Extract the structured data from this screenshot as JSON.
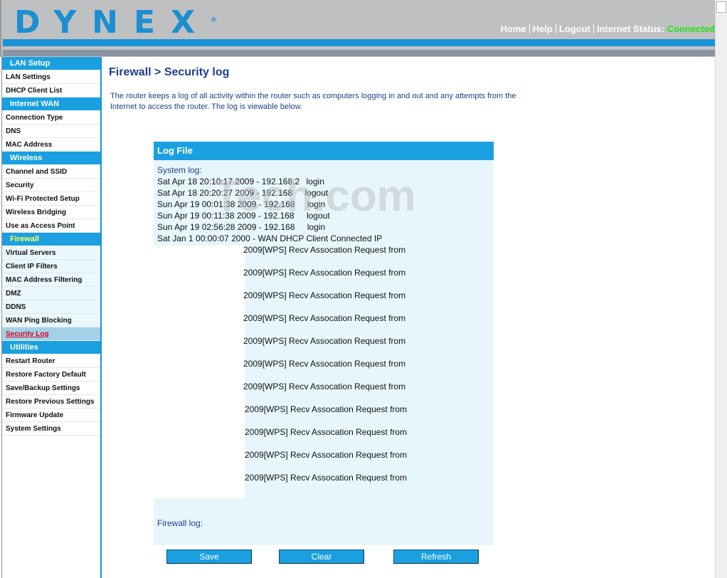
{
  "header": {
    "logo": "DYNEX",
    "logo_mark": "®",
    "links": {
      "home": "Home",
      "help": "Help",
      "logout": "Logout"
    },
    "status_label": "Internet Status:",
    "status_value": "Connected",
    "colors": {
      "brand_blue": "#1a93d6",
      "status_green": "#22e01a"
    }
  },
  "sidebar": {
    "sections": [
      {
        "title": "LAN Setup",
        "items": [
          "LAN Settings",
          "DHCP Client List"
        ]
      },
      {
        "title": "Internet WAN",
        "items": [
          "Connection Type",
          "DNS",
          "MAC Address"
        ]
      },
      {
        "title": "Wireless",
        "items": [
          "Channel and SSID",
          "Security",
          "Wi-Fi Protected Setup",
          "Wireless Bridging",
          "Use as Access Point"
        ]
      },
      {
        "title": "Firewall",
        "items": [
          "Virtual Servers",
          "Client IP Filters",
          "MAC Address Filtering",
          "DMZ",
          "DDNS",
          "WAN Ping Blocking",
          "Security Log"
        ]
      },
      {
        "title": "Utilities",
        "items": [
          "Restart Router",
          "Restore Factory Default",
          "Save/Backup Settings",
          "Restore Previous Settings",
          "Firmware Update",
          "System Settings"
        ]
      }
    ],
    "active_section": "Firewall",
    "selected_item": "Security Log"
  },
  "main": {
    "title": "Firewall > Security log",
    "description": "The router keeps a log of all activity within the router such as computers logging in and out and any attempts from the Internet to access the router. The log is viewable below."
  },
  "log": {
    "header": "Log File",
    "system_label": "System log:",
    "system_entries": [
      {
        "time": "Sat Apr 18 20:10:17 2009 - 192.168.2",
        "event": "login"
      },
      {
        "time": "Sat Apr 18 20:20:27 2009 - 192.168",
        "event": "logout"
      },
      {
        "time": "Sun Apr 19 00:01:38 2009 - 192.168",
        "event": "login"
      },
      {
        "time": "Sun Apr 19 00:11:38 2009 - 192.168",
        "event": "logout"
      },
      {
        "time": "Sun Apr 19 02:56:28 2009 - 192.168",
        "event": "login"
      },
      {
        "time": "Sat Jan 1 00:00:07 2000 - WAN DHCP Client Connected IP",
        "event": ""
      }
    ],
    "wps_entries": [
      "2009[WPS] Recv Assocation Request from",
      "2009[WPS] Recv Assocation Request from",
      "2009[WPS] Recv Assocation Request from",
      "2009[WPS] Recv Assocation Request from",
      "2009[WPS] Recv Assocation Request from",
      "2009[WPS] Recv Assocation Request from",
      "2009[WPS] Recv Assocation Request from",
      "2009[WPS] Recv Assocation Request from",
      "2009[WPS] Recv Assocation Request from",
      "2009[WPS] Recv Assocation Request from",
      "2009[WPS] Recv Assocation Request from"
    ],
    "firewall_label": "Firewall log:"
  },
  "watermark": "Tech.com",
  "buttons": {
    "save": "Save",
    "clear": "Clear",
    "refresh": "Refresh"
  }
}
